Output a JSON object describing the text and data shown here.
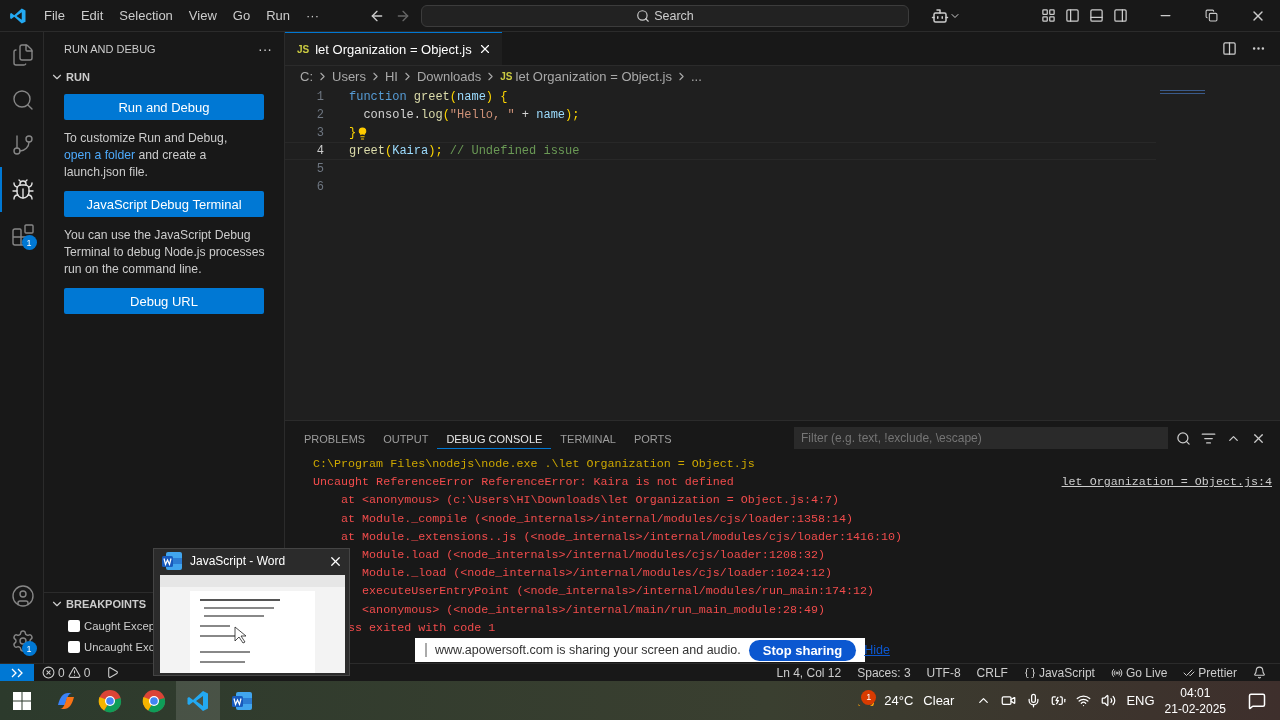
{
  "title_bar": {
    "menu": [
      "File",
      "Edit",
      "Selection",
      "View",
      "Go",
      "Run",
      "···"
    ],
    "search": "Search"
  },
  "activity_bar": {
    "items": [
      {
        "kind": "explorer",
        "selected": false
      },
      {
        "kind": "search",
        "selected": false
      },
      {
        "kind": "source_control",
        "selected": false
      },
      {
        "kind": "run_debug",
        "selected": true
      },
      {
        "kind": "extensions",
        "selected": false,
        "badge": "1"
      }
    ],
    "bottom": [
      {
        "kind": "account"
      },
      {
        "kind": "settings",
        "badge": "1"
      }
    ]
  },
  "sidebar": {
    "title": "RUN AND DEBUG",
    "more": "···",
    "section": {
      "label": "RUN",
      "expanded": true
    },
    "run_button": "Run and Debug",
    "customize_text": "To customize Run and Debug, ",
    "customize_link": "open a folder",
    "customize_rest": " and create a launch.json file.",
    "terminal_button": "JavaScript Debug Terminal",
    "terminal_text": "You can use the JavaScript Debug Terminal to debug Node.js processes run on the command line.",
    "url_button": "Debug URL",
    "breakpoints": {
      "label": "BREAKPOINTS",
      "expanded": true,
      "items": [
        {
          "label": "Caught Excep",
          "checked": false
        },
        {
          "label": "Uncaught Exc",
          "checked": false
        }
      ]
    }
  },
  "editor": {
    "tab": {
      "icon": "JS",
      "label": "let Organization = Object.js"
    },
    "breadcrumb": [
      "C:",
      "Users",
      "HI",
      "Downloads",
      "let Organization = Object.js",
      "..."
    ],
    "breadcrumb_icon": "JS",
    "lines": [
      {
        "number": "1",
        "current": false,
        "lightbulb": false,
        "tokens": [
          {
            "text": "function ",
            "kind": "keyword"
          },
          {
            "text": "greet",
            "kind": "function"
          },
          {
            "text": "(",
            "kind": "punct"
          },
          {
            "text": "name",
            "kind": "param"
          },
          {
            "text": ") {",
            "kind": "punct"
          }
        ]
      },
      {
        "number": "2",
        "current": false,
        "lightbulb": false,
        "tokens": [
          {
            "text": "  console",
            "kind": "plain"
          },
          {
            "text": ".",
            "kind": "plain"
          },
          {
            "text": "log",
            "kind": "function"
          },
          {
            "text": "(",
            "kind": "punct"
          },
          {
            "text": "\"Hello, \"",
            "kind": "string"
          },
          {
            "text": " + ",
            "kind": "plain"
          },
          {
            "text": "name",
            "kind": "param"
          },
          {
            "text": ");",
            "kind": "punct"
          }
        ]
      },
      {
        "number": "3",
        "current": false,
        "lightbulb": true,
        "tokens": [
          {
            "text": "}",
            "kind": "punct"
          }
        ]
      },
      {
        "number": "4",
        "current": true,
        "lightbulb": false,
        "tokens": [
          {
            "text": "greet",
            "kind": "function"
          },
          {
            "text": "(",
            "kind": "punct"
          },
          {
            "text": "Kaira",
            "kind": "param"
          },
          {
            "text": "); ",
            "kind": "punct"
          },
          {
            "text": "// Undefined issue",
            "kind": "comment"
          }
        ]
      },
      {
        "number": "5",
        "current": false,
        "lightbulb": false
      },
      {
        "number": "6",
        "current": false,
        "lightbulb": false
      }
    ]
  },
  "panel": {
    "tabs": [
      {
        "label": "PROBLEMS",
        "selected": false
      },
      {
        "label": "OUTPUT",
        "selected": false
      },
      {
        "label": "DEBUG CONSOLE",
        "selected": true
      },
      {
        "label": "TERMINAL",
        "selected": false
      },
      {
        "label": "PORTS",
        "selected": false
      }
    ],
    "filter_placeholder": "Filter (e.g. text, !exclude, \\escape)",
    "console": [
      {
        "kind": "command",
        "text": "C:\\Program Files\\nodejs\\node.exe .\\let Organization = Object.js"
      },
      {
        "kind": "error",
        "text": "Uncaught ReferenceError ReferenceError: Kaira is not defined",
        "link": "let Organization = Object.js:4"
      },
      {
        "kind": "stack",
        "text": "at <anonymous> (c:\\Users\\HI\\Downloads\\let Organization = Object.js:4:7)"
      },
      {
        "kind": "stack",
        "text": "at Module._compile (<node_internals>/internal/modules/cjs/loader:1358:14)"
      },
      {
        "kind": "stack",
        "text": "at Module._extensions..js (<node_internals>/internal/modules/cjs/loader:1416:10)"
      },
      {
        "kind": "clipped",
        "text": "Module.load (<node_internals>/internal/modules/cjs/loader:1208:32)"
      },
      {
        "kind": "clipped",
        "text": "Module._load (<node_internals>/internal/modules/cjs/loader:1024:12)"
      },
      {
        "kind": "clipped",
        "text": "executeUserEntryPoint (<node_internals>/internal/modules/run_main:174:12)"
      },
      {
        "kind": "clipped",
        "text": "<anonymous> (<node_internals>/internal/main/run_main_module:28:49)"
      },
      {
        "kind": "exit",
        "text": "ss exited with code 1"
      }
    ]
  },
  "status_bar": {
    "errors": "0",
    "warnings": "0",
    "items": [
      {
        "kind": "text",
        "text": "Ln 4, Col 12"
      },
      {
        "kind": "text",
        "text": "Spaces: 3"
      },
      {
        "kind": "text",
        "text": "UTF-8"
      },
      {
        "kind": "text",
        "text": "CRLF"
      },
      {
        "kind": "braces",
        "text": "JavaScript"
      },
      {
        "kind": "broadcast",
        "text": "Go Live"
      },
      {
        "kind": "checks",
        "text": "Prettier"
      }
    ]
  },
  "word_preview": {
    "title": "JavaScript - Word"
  },
  "share_bar": {
    "message": "www.apowersoft.com is sharing your screen and audio.",
    "stop": "Stop sharing",
    "hide": "Hide"
  },
  "taskbar": {
    "apps": [
      {
        "kind": "copilot",
        "selected": false
      },
      {
        "kind": "chrome",
        "selected": false
      },
      {
        "kind": "chrome",
        "selected": false
      },
      {
        "kind": "vscode",
        "selected": true
      },
      {
        "kind": "word",
        "selected": false
      }
    ],
    "weather_badge": "1",
    "temperature": "24°C",
    "weather": "Clear",
    "language": "ENG",
    "time": "04:01",
    "date": "21-02-2025"
  }
}
